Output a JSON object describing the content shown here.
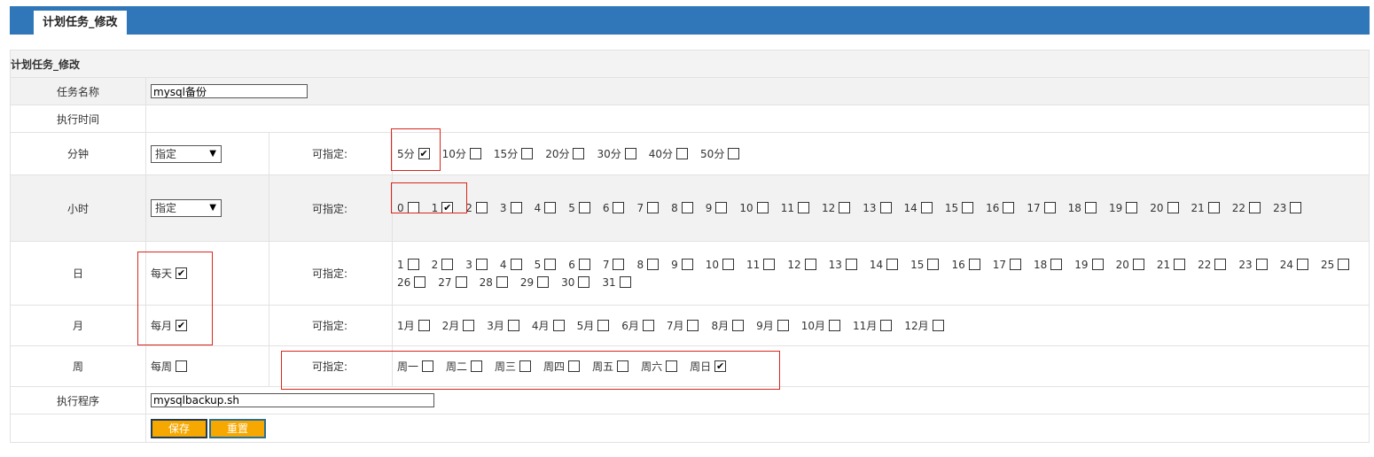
{
  "tab_title": "计划任务_修改",
  "form": {
    "section_title": "计划任务_修改",
    "task_name": {
      "label": "任务名称",
      "value": "mysql备份"
    },
    "exec_time": {
      "label": "执行时间"
    },
    "minute": {
      "label": "分钟",
      "mode": "指定",
      "spec_label": "可指定:",
      "options": [
        {
          "label": "5分",
          "checked": true
        },
        {
          "label": "10分",
          "checked": false
        },
        {
          "label": "15分",
          "checked": false
        },
        {
          "label": "20分",
          "checked": false
        },
        {
          "label": "30分",
          "checked": false
        },
        {
          "label": "40分",
          "checked": false
        },
        {
          "label": "50分",
          "checked": false
        }
      ]
    },
    "hour": {
      "label": "小时",
      "mode": "指定",
      "spec_label": "可指定:",
      "options": [
        {
          "label": "0",
          "checked": false
        },
        {
          "label": "1",
          "checked": true
        },
        {
          "label": "2",
          "checked": false
        },
        {
          "label": "3",
          "checked": false
        },
        {
          "label": "4",
          "checked": false
        },
        {
          "label": "5",
          "checked": false
        },
        {
          "label": "6",
          "checked": false
        },
        {
          "label": "7",
          "checked": false
        },
        {
          "label": "8",
          "checked": false
        },
        {
          "label": "9",
          "checked": false
        },
        {
          "label": "10",
          "checked": false
        },
        {
          "label": "11",
          "checked": false
        },
        {
          "label": "12",
          "checked": false
        },
        {
          "label": "13",
          "checked": false
        },
        {
          "label": "14",
          "checked": false
        },
        {
          "label": "15",
          "checked": false
        },
        {
          "label": "16",
          "checked": false
        },
        {
          "label": "17",
          "checked": false
        },
        {
          "label": "18",
          "checked": false
        },
        {
          "label": "19",
          "checked": false
        },
        {
          "label": "20",
          "checked": false
        },
        {
          "label": "21",
          "checked": false
        },
        {
          "label": "22",
          "checked": false
        },
        {
          "label": "23",
          "checked": false
        }
      ]
    },
    "day": {
      "label": "日",
      "every_label": "每天",
      "every_checked": true,
      "spec_label": "可指定:",
      "options": [
        {
          "label": "1",
          "checked": false
        },
        {
          "label": "2",
          "checked": false
        },
        {
          "label": "3",
          "checked": false
        },
        {
          "label": "4",
          "checked": false
        },
        {
          "label": "5",
          "checked": false
        },
        {
          "label": "6",
          "checked": false
        },
        {
          "label": "7",
          "checked": false
        },
        {
          "label": "8",
          "checked": false
        },
        {
          "label": "9",
          "checked": false
        },
        {
          "label": "10",
          "checked": false
        },
        {
          "label": "11",
          "checked": false
        },
        {
          "label": "12",
          "checked": false
        },
        {
          "label": "13",
          "checked": false
        },
        {
          "label": "14",
          "checked": false
        },
        {
          "label": "15",
          "checked": false
        },
        {
          "label": "16",
          "checked": false
        },
        {
          "label": "17",
          "checked": false
        },
        {
          "label": "18",
          "checked": false
        },
        {
          "label": "19",
          "checked": false
        },
        {
          "label": "20",
          "checked": false
        },
        {
          "label": "21",
          "checked": false
        },
        {
          "label": "22",
          "checked": false
        },
        {
          "label": "23",
          "checked": false
        },
        {
          "label": "24",
          "checked": false
        },
        {
          "label": "25",
          "checked": false
        },
        {
          "label": "26",
          "checked": false
        },
        {
          "label": "27",
          "checked": false
        },
        {
          "label": "28",
          "checked": false
        },
        {
          "label": "29",
          "checked": false
        },
        {
          "label": "30",
          "checked": false
        },
        {
          "label": "31",
          "checked": false
        }
      ]
    },
    "month": {
      "label": "月",
      "every_label": "每月",
      "every_checked": true,
      "spec_label": "可指定:",
      "options": [
        {
          "label": "1月",
          "checked": false
        },
        {
          "label": "2月",
          "checked": false
        },
        {
          "label": "3月",
          "checked": false
        },
        {
          "label": "4月",
          "checked": false
        },
        {
          "label": "5月",
          "checked": false
        },
        {
          "label": "6月",
          "checked": false
        },
        {
          "label": "7月",
          "checked": false
        },
        {
          "label": "8月",
          "checked": false
        },
        {
          "label": "9月",
          "checked": false
        },
        {
          "label": "10月",
          "checked": false
        },
        {
          "label": "11月",
          "checked": false
        },
        {
          "label": "12月",
          "checked": false
        }
      ]
    },
    "week": {
      "label": "周",
      "every_label": "每周",
      "every_checked": false,
      "spec_label": "可指定:",
      "options": [
        {
          "label": "周一",
          "checked": false
        },
        {
          "label": "周二",
          "checked": false
        },
        {
          "label": "周三",
          "checked": false
        },
        {
          "label": "周四",
          "checked": false
        },
        {
          "label": "周五",
          "checked": false
        },
        {
          "label": "周六",
          "checked": false
        },
        {
          "label": "周日",
          "checked": true
        }
      ]
    },
    "program": {
      "label": "执行程序",
      "value": "mysqlbackup.sh"
    },
    "save_label": "保存",
    "reset_label": "重置"
  },
  "colors": {
    "header_bar": "#2f77b8",
    "button": "#f7a800",
    "highlight": "#d9261c",
    "row_shade": "#f2f2f2"
  }
}
